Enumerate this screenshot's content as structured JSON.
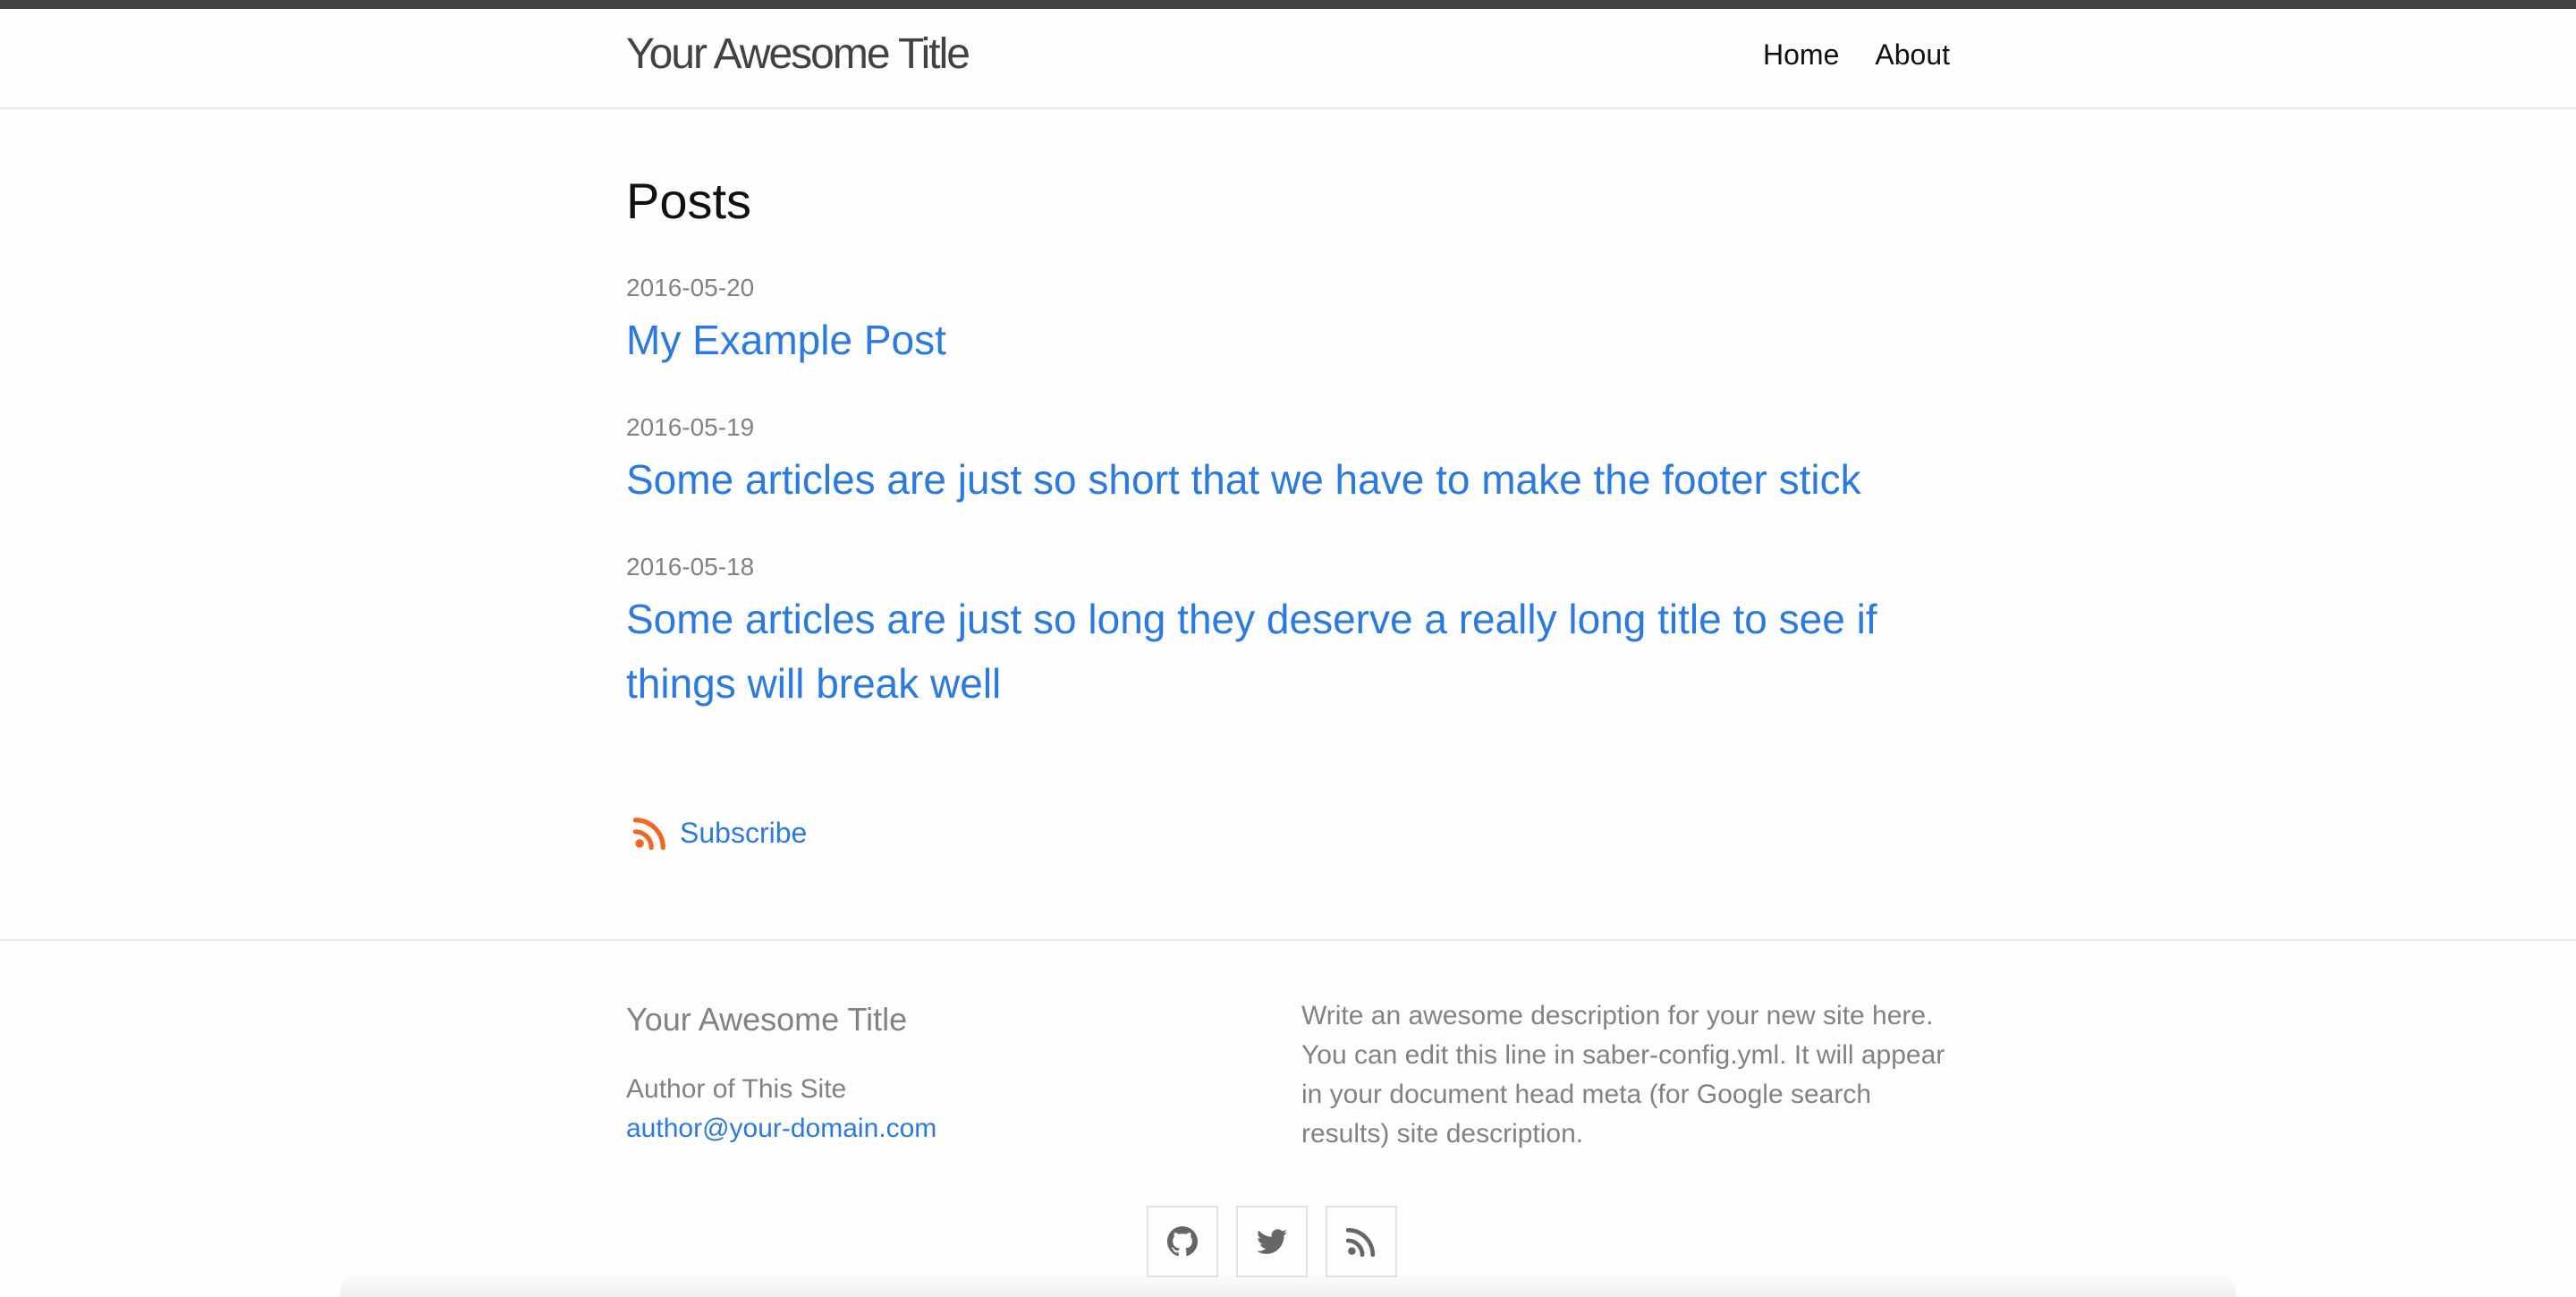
{
  "header": {
    "site_title": "Your Awesome Title",
    "nav": [
      {
        "label": "Home"
      },
      {
        "label": "About"
      }
    ]
  },
  "main": {
    "heading": "Posts",
    "posts": [
      {
        "date": "2016-05-20",
        "title": "My Example Post"
      },
      {
        "date": "2016-05-19",
        "title": "Some articles are just so short that we have to make the footer stick"
      },
      {
        "date": "2016-05-18",
        "title": "Some articles are just so long they deserve a really long title to see if things will break well"
      }
    ],
    "subscribe_label": "Subscribe",
    "subscribe_icon": "rss-icon"
  },
  "footer": {
    "heading": "Your Awesome Title",
    "author": "Author of This Site",
    "email": "author@your-domain.com",
    "description": "Write an awesome description for your new site here. You can edit this line in saber-config.yml. It will appear in your document head meta (for Google search results) site description.",
    "social": [
      {
        "icon": "github-icon"
      },
      {
        "icon": "twitter-icon"
      },
      {
        "icon": "rss-icon"
      }
    ]
  },
  "colors": {
    "link": "#2a7ae2",
    "meta": "#828282",
    "rss": "#f26522",
    "top_strip": "#424242"
  }
}
